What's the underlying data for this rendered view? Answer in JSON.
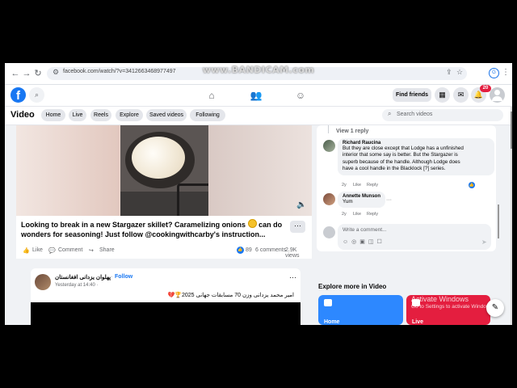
{
  "watermark": "www.BANDICAM.com",
  "browser": {
    "url": "facebook.com/watch/?v=3412663468977497",
    "profile_letter": "G"
  },
  "fb_nav": {
    "logo": "f",
    "find_friends": "Find friends",
    "notification_count": "20"
  },
  "watch": {
    "title": "Video",
    "tabs": [
      "Home",
      "Live",
      "Reels",
      "Explore",
      "Saved videos",
      "Following"
    ],
    "search_placeholder": "Search videos"
  },
  "main_post": {
    "caption_part1": "Looking to break in a new Stargazer skillet? Caramelizing onions",
    "caption_part2": "can do wonders for seasoning! Just follow @cookingwithcarby's instruction...",
    "more": "···",
    "like": "Like",
    "comment": "Comment",
    "share": "Share",
    "reactions": "89",
    "comments": "6 comments",
    "views": "2.9K views"
  },
  "second_post": {
    "page_name": "پهلوان یزدانی افغانستان",
    "separator": "·",
    "follow": "Follow",
    "time": "Yesterday at 14:40 ·",
    "more": "···",
    "text": "امیر محمد یزدانی وزن 70 مسابقات جهانی 2025🏆💔"
  },
  "comments_panel": {
    "view_reply": "View 1 reply",
    "comments": [
      {
        "name": "Richard Raucina",
        "lines": [
          "But they are close except that Lodge has a unfinished",
          "interior that some say is better. But the Stargazer is",
          "superb because of the handle. Although Lodge does",
          "have a cool handle in the Blacklock [?] series."
        ],
        "age": "2y",
        "like": "Like",
        "reply": "Reply"
      },
      {
        "name": "Annette Munson",
        "lines": [
          "Yum"
        ],
        "age": "2y",
        "like": "Like",
        "reply": "Reply"
      }
    ],
    "more": "···",
    "write_placeholder": "Write a comment...",
    "write_tools": "☺◎▣◫☐",
    "send": "➤"
  },
  "explore": {
    "title": "Explore more in Video",
    "tiles": [
      {
        "label": "Home",
        "color": "#2d88ff"
      },
      {
        "label": "Live",
        "color": "#e41e3f"
      }
    ]
  },
  "windows_notice": {
    "title": "Activate Windows",
    "subtitle": "Go to Settings to activate Windows."
  },
  "icons": {
    "back": "←",
    "forward": "→",
    "reload": "↻",
    "tune": "⚙",
    "share": "⇪",
    "star": "☆",
    "search": "⌕",
    "apps": "▦",
    "messenger": "✉",
    "bell": "🔔",
    "home": "⌂",
    "friends": "👥",
    "groups": "☺",
    "mute": "🔈",
    "edit": "✎",
    "thumb": "👍",
    "comment": "💬",
    "share_arrow": "↪"
  }
}
